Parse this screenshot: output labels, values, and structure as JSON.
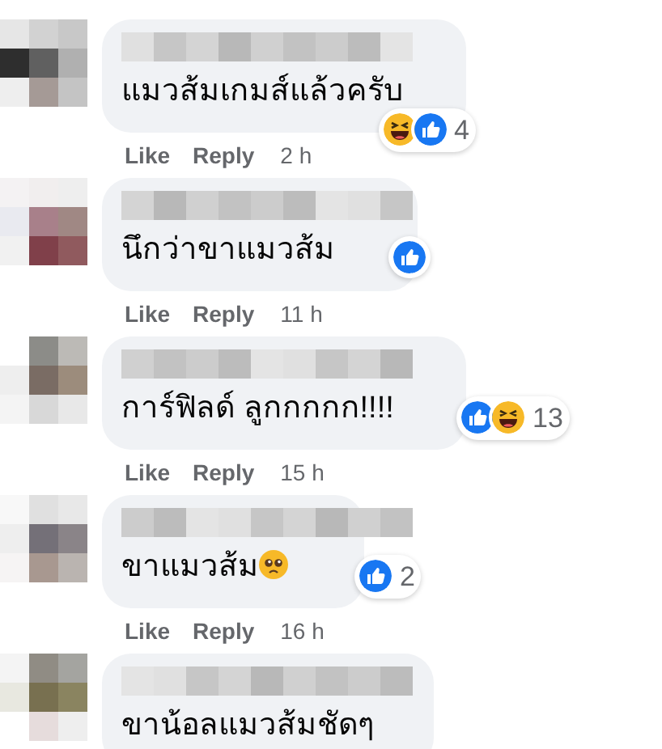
{
  "comments": [
    {
      "text": "แมวส้มเกมส์แล้วครับ",
      "reaction_badge": {
        "kind": "overlap",
        "icons": [
          {
            "kind": "haha"
          },
          {
            "kind": "like"
          }
        ],
        "count": "4"
      },
      "actions": [
        "Like",
        "Reply"
      ],
      "time": "2 h"
    },
    {
      "text": "นึกว่าขาแมวส้ม",
      "reaction_badge": {
        "kind": "side",
        "icons": [
          {
            "kind": "like"
          }
        ]
      },
      "actions": [
        "Like",
        "Reply"
      ],
      "time": "11 h"
    },
    {
      "text": "การ์ฟิลด์ ลูกกกกก!!!!",
      "reaction_badge": {
        "kind": "outside",
        "icons": [
          {
            "kind": "like"
          },
          {
            "kind": "haha"
          }
        ],
        "count": "13"
      },
      "actions": [
        "Like",
        "Reply"
      ],
      "time": "15 h"
    },
    {
      "text": "ขาแมวส้ม",
      "emoji": {
        "kind": "pleading"
      },
      "reaction_badge": {
        "kind": "outside",
        "icons": [
          {
            "kind": "like"
          }
        ],
        "count": "2"
      },
      "actions": [
        "Like",
        "Reply"
      ],
      "time": "16 h"
    },
    {
      "text": "ขาน้อลแมวส้มชัดๆ"
    }
  ]
}
